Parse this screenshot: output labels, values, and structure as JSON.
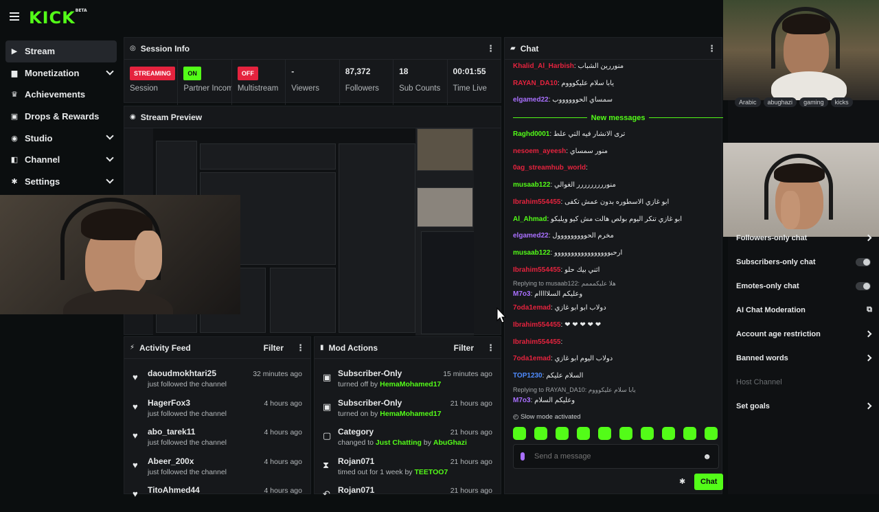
{
  "app": {
    "logo": "KICK",
    "logo_badge": "BETA"
  },
  "sidebar": {
    "items": [
      {
        "label": "Stream",
        "icon": "video-icon",
        "glyph": "▶",
        "active": true,
        "expandable": false
      },
      {
        "label": "Monetization",
        "icon": "money-icon",
        "glyph": "▆",
        "active": false,
        "expandable": true
      },
      {
        "label": "Achievements",
        "icon": "trophy-icon",
        "glyph": "♛",
        "active": false,
        "expandable": false
      },
      {
        "label": "Drops & Rewards",
        "icon": "gift-icon",
        "glyph": "▣",
        "active": false,
        "expandable": false
      },
      {
        "label": "Studio",
        "icon": "studio-icon",
        "glyph": "◉",
        "active": false,
        "expandable": true
      },
      {
        "label": "Channel",
        "icon": "channel-icon",
        "glyph": "◧",
        "active": false,
        "expandable": true
      },
      {
        "label": "Settings",
        "icon": "gear-icon",
        "glyph": "✱",
        "active": false,
        "expandable": true
      }
    ]
  },
  "session": {
    "title": "Session Info",
    "cells": [
      {
        "value": "STREAMING",
        "kind": "badge-red",
        "label": "Session"
      },
      {
        "value": "ON",
        "kind": "badge-green",
        "label": "Partner Income"
      },
      {
        "value": "OFF",
        "kind": "badge-red",
        "label": "Multistream"
      },
      {
        "value": "-",
        "kind": "text",
        "label": "Viewers"
      },
      {
        "value": "87,372",
        "kind": "text",
        "label": "Followers"
      },
      {
        "value": "18",
        "kind": "text",
        "label": "Sub Counts"
      },
      {
        "value": "00:01:55",
        "kind": "text",
        "label": "Time Live"
      }
    ]
  },
  "preview": {
    "title": "Stream Preview"
  },
  "activity": {
    "title": "Activity Feed",
    "filter": "Filter",
    "items": [
      {
        "name": "daoudmokhtari25",
        "sub": "just followed the channel",
        "time": "32 minutes ago"
      },
      {
        "name": "HagerFox3",
        "sub": "just followed the channel",
        "time": "4 hours ago"
      },
      {
        "name": "abo_tarek11",
        "sub": "just followed the channel",
        "time": "4 hours ago"
      },
      {
        "name": "Abeer_200x",
        "sub": "just followed the channel",
        "time": "4 hours ago"
      },
      {
        "name": "TitoAhmed44",
        "sub": "",
        "time": "4 hours ago"
      }
    ]
  },
  "mod": {
    "title": "Mod Actions",
    "filter": "Filter",
    "items": [
      {
        "icon": "gift-icon",
        "glyph": "▣",
        "name": "Subscriber-Only",
        "pre": "turned off by ",
        "hl": "HemaMohamed17",
        "post": "",
        "hl2": "",
        "time": "15 minutes ago"
      },
      {
        "icon": "gift-icon",
        "glyph": "▣",
        "name": "Subscriber-Only",
        "pre": "turned on by ",
        "hl": "HemaMohamed17",
        "post": "",
        "hl2": "",
        "time": "21 hours ago"
      },
      {
        "icon": "category-icon",
        "glyph": "▢",
        "name": "Category",
        "pre": "changed to ",
        "hl": "Just Chatting",
        "post": " by ",
        "hl2": "AbuGhazi",
        "time": "21 hours ago"
      },
      {
        "icon": "hourglass-icon",
        "glyph": "⧗",
        "name": "Rojan071",
        "pre": "timed out for 1 week by ",
        "hl": "TEETOO7",
        "post": "",
        "hl2": "",
        "time": "21 hours ago"
      },
      {
        "icon": "undo-icon",
        "glyph": "↶",
        "name": "Rojan071",
        "pre": "",
        "hl": "",
        "post": "",
        "hl2": "",
        "time": "21 hours ago"
      }
    ]
  },
  "chat": {
    "title": "Chat",
    "new_messages": "New messages",
    "top_messages": [
      {
        "user": "Khalid_Al_Harbish",
        "color": "#e5233e",
        "text": "منوررين الشباب"
      },
      {
        "user": "RAYAN_DA10",
        "color": "#e5233e",
        "text": "يابا سلام عليكوووم"
      },
      {
        "user": "elgamed22",
        "color": "#a970ff",
        "text": "سمساي الحووووووب"
      }
    ],
    "messages": [
      {
        "user": "Raghd0001",
        "color": "#53fc18",
        "text": "ترى الانشار فيه التي علط",
        "reply": ""
      },
      {
        "user": "nesoem_ayeesh",
        "color": "#e5233e",
        "text": "منور سمساي",
        "reply": ""
      },
      {
        "user": "0ag_streamhub_world",
        "color": "#e5233e",
        "text": "",
        "reply": ""
      },
      {
        "user": "musaab122",
        "color": "#53fc18",
        "text": "منوررررررررر الغوالي",
        "reply": ""
      },
      {
        "user": "Ibrahim554455",
        "color": "#e5233e",
        "text": "ابو غازي الاسطوره بدون عمش تكفى",
        "reply": ""
      },
      {
        "user": "Al_Ahmad",
        "color": "#53fc18",
        "text": "ابو غازي تنكر اليوم بولص هالت مش كيو ويلبكو",
        "reply": ""
      },
      {
        "user": "elgamed22",
        "color": "#a970ff",
        "text": "مخرم الحووووووووول",
        "reply": ""
      },
      {
        "user": "musaab122",
        "color": "#53fc18",
        "text": "ارحبووووووووووووووووو",
        "reply": ""
      },
      {
        "user": "Ibrahim554455",
        "color": "#e5233e",
        "text": "اثني بيك حلو",
        "reply": ""
      },
      {
        "user": "M7o3",
        "color": "#a970ff",
        "text": "وعليكم السلااااام",
        "reply": "Replying to musaab122: هلا عليكمممم"
      },
      {
        "user": "7oda1emad",
        "color": "#e5233e",
        "text": "دولاب ابو ابو غازي",
        "reply": ""
      },
      {
        "user": "Ibrahim554455",
        "color": "#e5233e",
        "text": "❤ ❤ ❤ ❤ ❤",
        "reply": ""
      },
      {
        "user": "Ibrahim554455",
        "color": "#e5233e",
        "text": "",
        "reply": ""
      },
      {
        "user": "7oda1emad",
        "color": "#e5233e",
        "text": "دولاب اليوم ابو غازي",
        "reply": ""
      },
      {
        "user": "TOP1230",
        "color": "#4f8cff",
        "text": "السلام عليكم",
        "reply": ""
      },
      {
        "user": "M7o3",
        "color": "#a970ff",
        "text": "وعليكم السلام",
        "reply": "Replying to RAYAN_DA10: يابا سلام عليكوووم"
      }
    ],
    "slow_mode": "Slow mode activated",
    "placeholder": "Send a message",
    "send_label": "Chat"
  },
  "right_panel": {
    "tags": [
      "Arabic",
      "abughazi",
      "gaming",
      "kicks"
    ],
    "settings": [
      {
        "label": "Followers-only chat",
        "control": "arrow",
        "dim": false
      },
      {
        "label": "Subscribers-only chat",
        "control": "toggle",
        "dim": false
      },
      {
        "label": "Emotes-only chat",
        "control": "toggle",
        "dim": false
      },
      {
        "label": "AI Chat Moderation",
        "control": "external",
        "dim": false
      },
      {
        "label": "Account age restriction",
        "control": "arrow",
        "dim": false
      },
      {
        "label": "Banned words",
        "control": "arrow",
        "dim": false
      },
      {
        "label": "Host Channel",
        "control": "none",
        "dim": true
      },
      {
        "label": "Set goals",
        "control": "arrow",
        "dim": false
      }
    ]
  },
  "colors": {
    "brand": "#53fc18",
    "danger": "#e5233e",
    "panel": "#16181b",
    "bg": "#0b0e0f"
  }
}
